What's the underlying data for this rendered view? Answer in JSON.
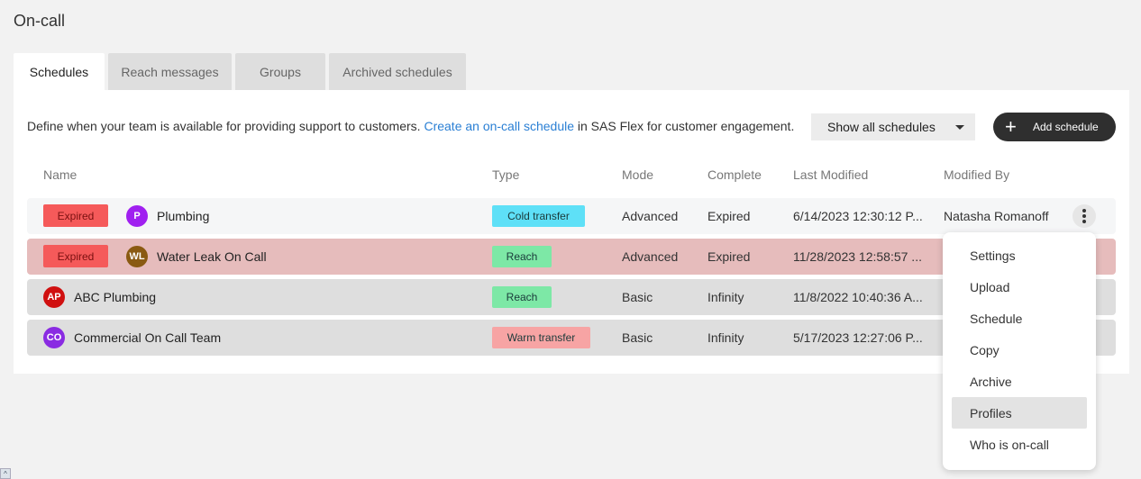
{
  "page": {
    "title": "On-call"
  },
  "tabs": [
    {
      "label": "Schedules",
      "active": true
    },
    {
      "label": "Reach messages",
      "active": false
    },
    {
      "label": "Groups",
      "active": false
    },
    {
      "label": "Archived schedules",
      "active": false
    }
  ],
  "description": {
    "prefix": "Define when your team is available for providing support to customers.",
    "link": "Create an on-call schedule",
    "suffix": "in SAS Flex for customer engagement."
  },
  "filter": {
    "selected": "Show all schedules"
  },
  "add_button": {
    "label": "Add schedule"
  },
  "table": {
    "headers": {
      "name": "Name",
      "type": "Type",
      "mode": "Mode",
      "complete": "Complete",
      "last_modified": "Last Modified",
      "modified_by": "Modified By"
    },
    "rows": [
      {
        "status": "Expired",
        "initials": "P",
        "avatar_color": "#a020f0",
        "name": "Plumbing",
        "type": "Cold transfer",
        "type_color": "#5ee0f7",
        "mode": "Advanced",
        "complete": "Expired",
        "last_modified": "6/14/2023 12:30:12 P...",
        "modified_by": "Natasha Romanoff",
        "row_color": "#f5f6f7"
      },
      {
        "status": "Expired",
        "initials": "WL",
        "avatar_color": "#8a5a12",
        "name": "Water Leak On Call",
        "type": "Reach",
        "type_color": "#7de8a6",
        "mode": "Advanced",
        "complete": "Expired",
        "last_modified": "11/28/2023 12:58:57 ...",
        "modified_by": "",
        "row_color": "#e6bcbc"
      },
      {
        "status": "",
        "initials": "AP",
        "avatar_color": "#d01010",
        "name": "ABC Plumbing",
        "type": "Reach",
        "type_color": "#7de8a6",
        "mode": "Basic",
        "complete": "Infinity",
        "last_modified": "11/8/2022 10:40:36 A...",
        "modified_by": "",
        "row_color": "#dedede"
      },
      {
        "status": "",
        "initials": "CO",
        "avatar_color": "#8a2be2",
        "name": "Commercial On Call Team",
        "type": "Warm transfer",
        "type_color": "#f7a4a4",
        "mode": "Basic",
        "complete": "Infinity",
        "last_modified": "5/17/2023 12:27:06 P...",
        "modified_by": "",
        "row_color": "#dedede"
      }
    ]
  },
  "context_menu": {
    "items": [
      "Settings",
      "Upload",
      "Schedule",
      "Copy",
      "Archive",
      "Profiles",
      "Who is on-call"
    ],
    "highlighted": "Profiles"
  }
}
